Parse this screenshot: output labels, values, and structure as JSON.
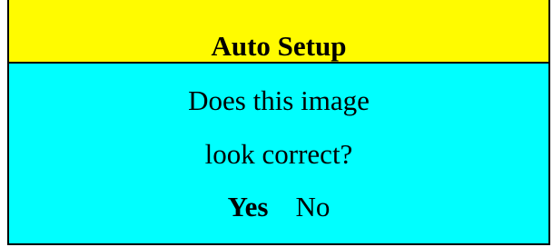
{
  "dialog": {
    "title": "Auto Setup",
    "message_line_1": "Does this image",
    "message_line_2": "look correct?",
    "buttons": {
      "yes_label": "Yes",
      "no_label": "No",
      "selected": "Yes"
    }
  },
  "colors": {
    "title_background": "#fffb00",
    "body_background": "#00ffff",
    "border": "#000000",
    "text": "#000000"
  }
}
